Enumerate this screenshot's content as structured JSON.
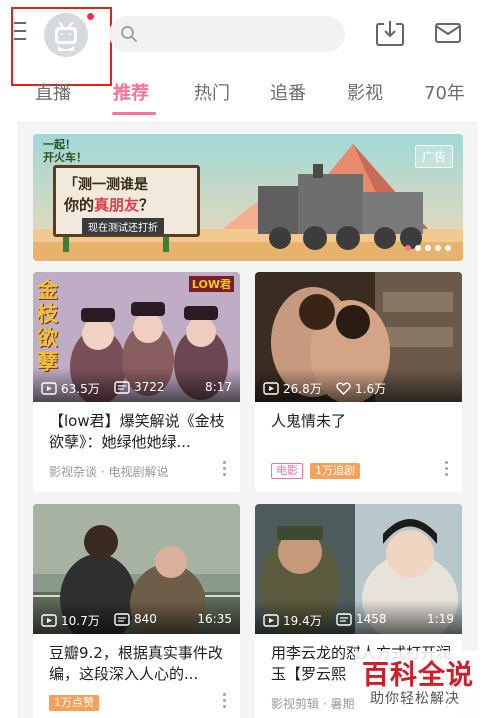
{
  "header": {
    "search_placeholder": "",
    "colors": {
      "accent": "#fb7299",
      "notification_dot": "#fb2d47"
    }
  },
  "tabs": [
    {
      "label": "直播",
      "active": false
    },
    {
      "label": "推荐",
      "active": true
    },
    {
      "label": "热门",
      "active": false
    },
    {
      "label": "追番",
      "active": false
    },
    {
      "label": "影视",
      "active": false
    },
    {
      "label": "70年",
      "active": false
    }
  ],
  "banner": {
    "ad_label": "广告",
    "top_text_1": "一起！",
    "top_text_2": "开火车！",
    "sign_line_1": "「测一测谁是",
    "sign_line_2_prefix": "你的",
    "sign_line_2_highlight": "真朋友",
    "sign_line_2_suffix": "？",
    "sign_button": "现在测试还打折",
    "dot_count": 5,
    "active_dot": 0
  },
  "cards": [
    {
      "views": "63.5万",
      "danmaku": "3722",
      "duration": "8:17",
      "title": "【low君】爆笑解说《金枝欲孽》：她绿他她绿...",
      "thumb_text": "金枝欲孽",
      "thumb_logo": "LOW君",
      "subtitle": "影视杂谈 · 电视剧解说",
      "tags": []
    },
    {
      "views": "26.8万",
      "likes": "1.6万",
      "title": "人鬼情未了",
      "subtitle": "",
      "tags": [
        {
          "text": "电影",
          "style": "outline"
        },
        {
          "text": "1万追剧",
          "style": "filled"
        }
      ]
    },
    {
      "views": "10.7万",
      "danmaku": "840",
      "duration": "16:35",
      "title": "豆瓣9.2，根据真实事件改编，这段深入人心的...",
      "subtitle": "",
      "tags": [
        {
          "text": "1万点赞",
          "style": "filled"
        }
      ]
    },
    {
      "views": "19.4万",
      "danmaku": "1458",
      "duration": "1:19",
      "title": "用李云龙的怼人方式打开润玉【罗云熙",
      "subtitle": "影视剪辑 · 暑期",
      "tags": []
    }
  ],
  "watermark": {
    "title": "百科全说",
    "subtitle": "助你轻松解决"
  }
}
